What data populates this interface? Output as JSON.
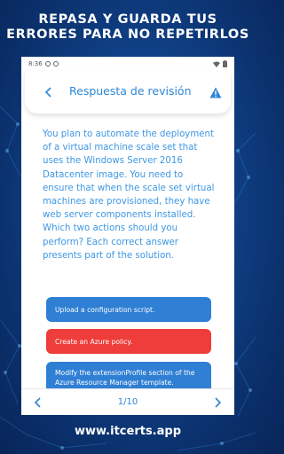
{
  "promo": {
    "line1": "REPASA Y GUARDA TUS",
    "line2": "ERRORES PARA NO REPETIRLOS"
  },
  "statusbar": {
    "time": "8:36",
    "icons": [
      "notification-icon",
      "notification-icon",
      "wifi-icon",
      "battery-icon"
    ]
  },
  "header": {
    "title": "Respuesta de revisión",
    "back_icon": "chevron-left-icon",
    "alert_icon": "warning-icon"
  },
  "question": {
    "text": "You plan to automate the deployment of a virtual machine scale set that uses the Windows Server 2016 Datacenter image. You need to ensure that when the scale set virtual machines are provisioned, they have web server components installed. Which two actions should you perform? Each correct answer presents part of the solution."
  },
  "answers": [
    {
      "text": "Upload a configuration script.",
      "color": "#2f7fd4"
    },
    {
      "text": "Create an Azure policy.",
      "color": "#ee3d3a"
    },
    {
      "text": "Modify the extensionProfile section of the Azure Resource Manager template.",
      "color": "#2f7fd4"
    }
  ],
  "footer": {
    "pager": "1/10",
    "prev_icon": "chevron-left-icon",
    "next_icon": "chevron-right-icon"
  },
  "brand_url": "www.itcerts.app",
  "colors": {
    "accent": "#2d86d6",
    "text_blue": "#3d97e3",
    "correct": "#2f7fd4",
    "wrong": "#ee3d3a",
    "background": "#0f3f84"
  }
}
